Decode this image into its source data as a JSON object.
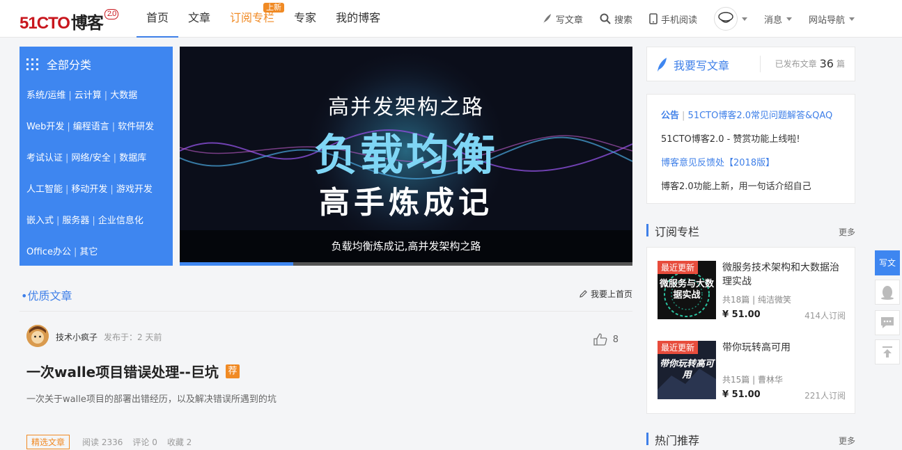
{
  "header": {
    "logo_main": "51CTO",
    "logo_text": "博客",
    "logo_version": "2.0",
    "nav": [
      {
        "label": "首页"
      },
      {
        "label": "文章"
      },
      {
        "label": "订阅专栏",
        "badge": "上新"
      },
      {
        "label": "专家"
      },
      {
        "label": "我的博客"
      }
    ],
    "tools": {
      "write": "写文章",
      "search": "搜索",
      "mobile": "手机阅读",
      "messages": "消息",
      "site_nav": "网站导航"
    }
  },
  "categories": {
    "title": "全部分类",
    "rows": [
      [
        "系统/运维",
        "云计算",
        "大数据"
      ],
      [
        "Web开发",
        "编程语言",
        "软件研发"
      ],
      [
        "考试认证",
        "网络/安全",
        "数据库"
      ],
      [
        "人工智能",
        "移动开发",
        "游戏开发"
      ],
      [
        "嵌入式",
        "服务器",
        "企业信息化"
      ],
      [
        "Office办公",
        "其它"
      ]
    ]
  },
  "banner": {
    "line1": "高并发架构之路",
    "line2": "负载均衡",
    "line3": "高手炼成记",
    "caption": "负载均衡炼成记,高并发架构之路",
    "progress": 0.25
  },
  "featured": {
    "title": "•优质文章",
    "link": "我要上首页"
  },
  "article": {
    "author": "技术小疯子",
    "time": "发布于：2 天前",
    "likes": "8",
    "title": "一次walle项目错误处理--巨坑",
    "tag": "荐",
    "desc": "一次关于walle项目的部署出错经历，以及解决错误所遇到的坑",
    "pill": "精选文章",
    "reads": "阅读 2336",
    "comments": "评论 0",
    "favorites": "收藏 2"
  },
  "write_box": {
    "button": "我要写文章",
    "published_label": "已发布文章",
    "published_count": "36",
    "unit": "篇"
  },
  "notice": {
    "label": "公告",
    "items": [
      "51CTO博客2.0常见问题解答&QAQ",
      "51CTO博客2.0 - 赞赏功能上线啦!",
      "博客意见反馈处【2018版】",
      "博客2.0功能上新，用一句话介绍自己"
    ]
  },
  "columns": {
    "title": "订阅专栏",
    "more": "更多",
    "items": [
      {
        "badge": "最近更新",
        "cover_text": "微服务与大数据实战",
        "title": "微服务技术架构和大数据治理实战",
        "info": "共18篇 | 纯洁微笑",
        "price": "¥ 51.00",
        "subs": "414人订阅"
      },
      {
        "badge": "最近更新",
        "cover_text": "带你玩转高可用",
        "title": "带你玩转高可用",
        "info": "共15篇 | 曹林华",
        "price": "¥ 51.00",
        "subs": "221人订阅"
      }
    ]
  },
  "hot": {
    "title": "热门推荐",
    "more": "更多"
  },
  "float_bar": {
    "write": "写文"
  },
  "colors": {
    "brand_red": "#c8161d",
    "accent_blue": "#3e86f0",
    "orange": "#f08a24"
  }
}
